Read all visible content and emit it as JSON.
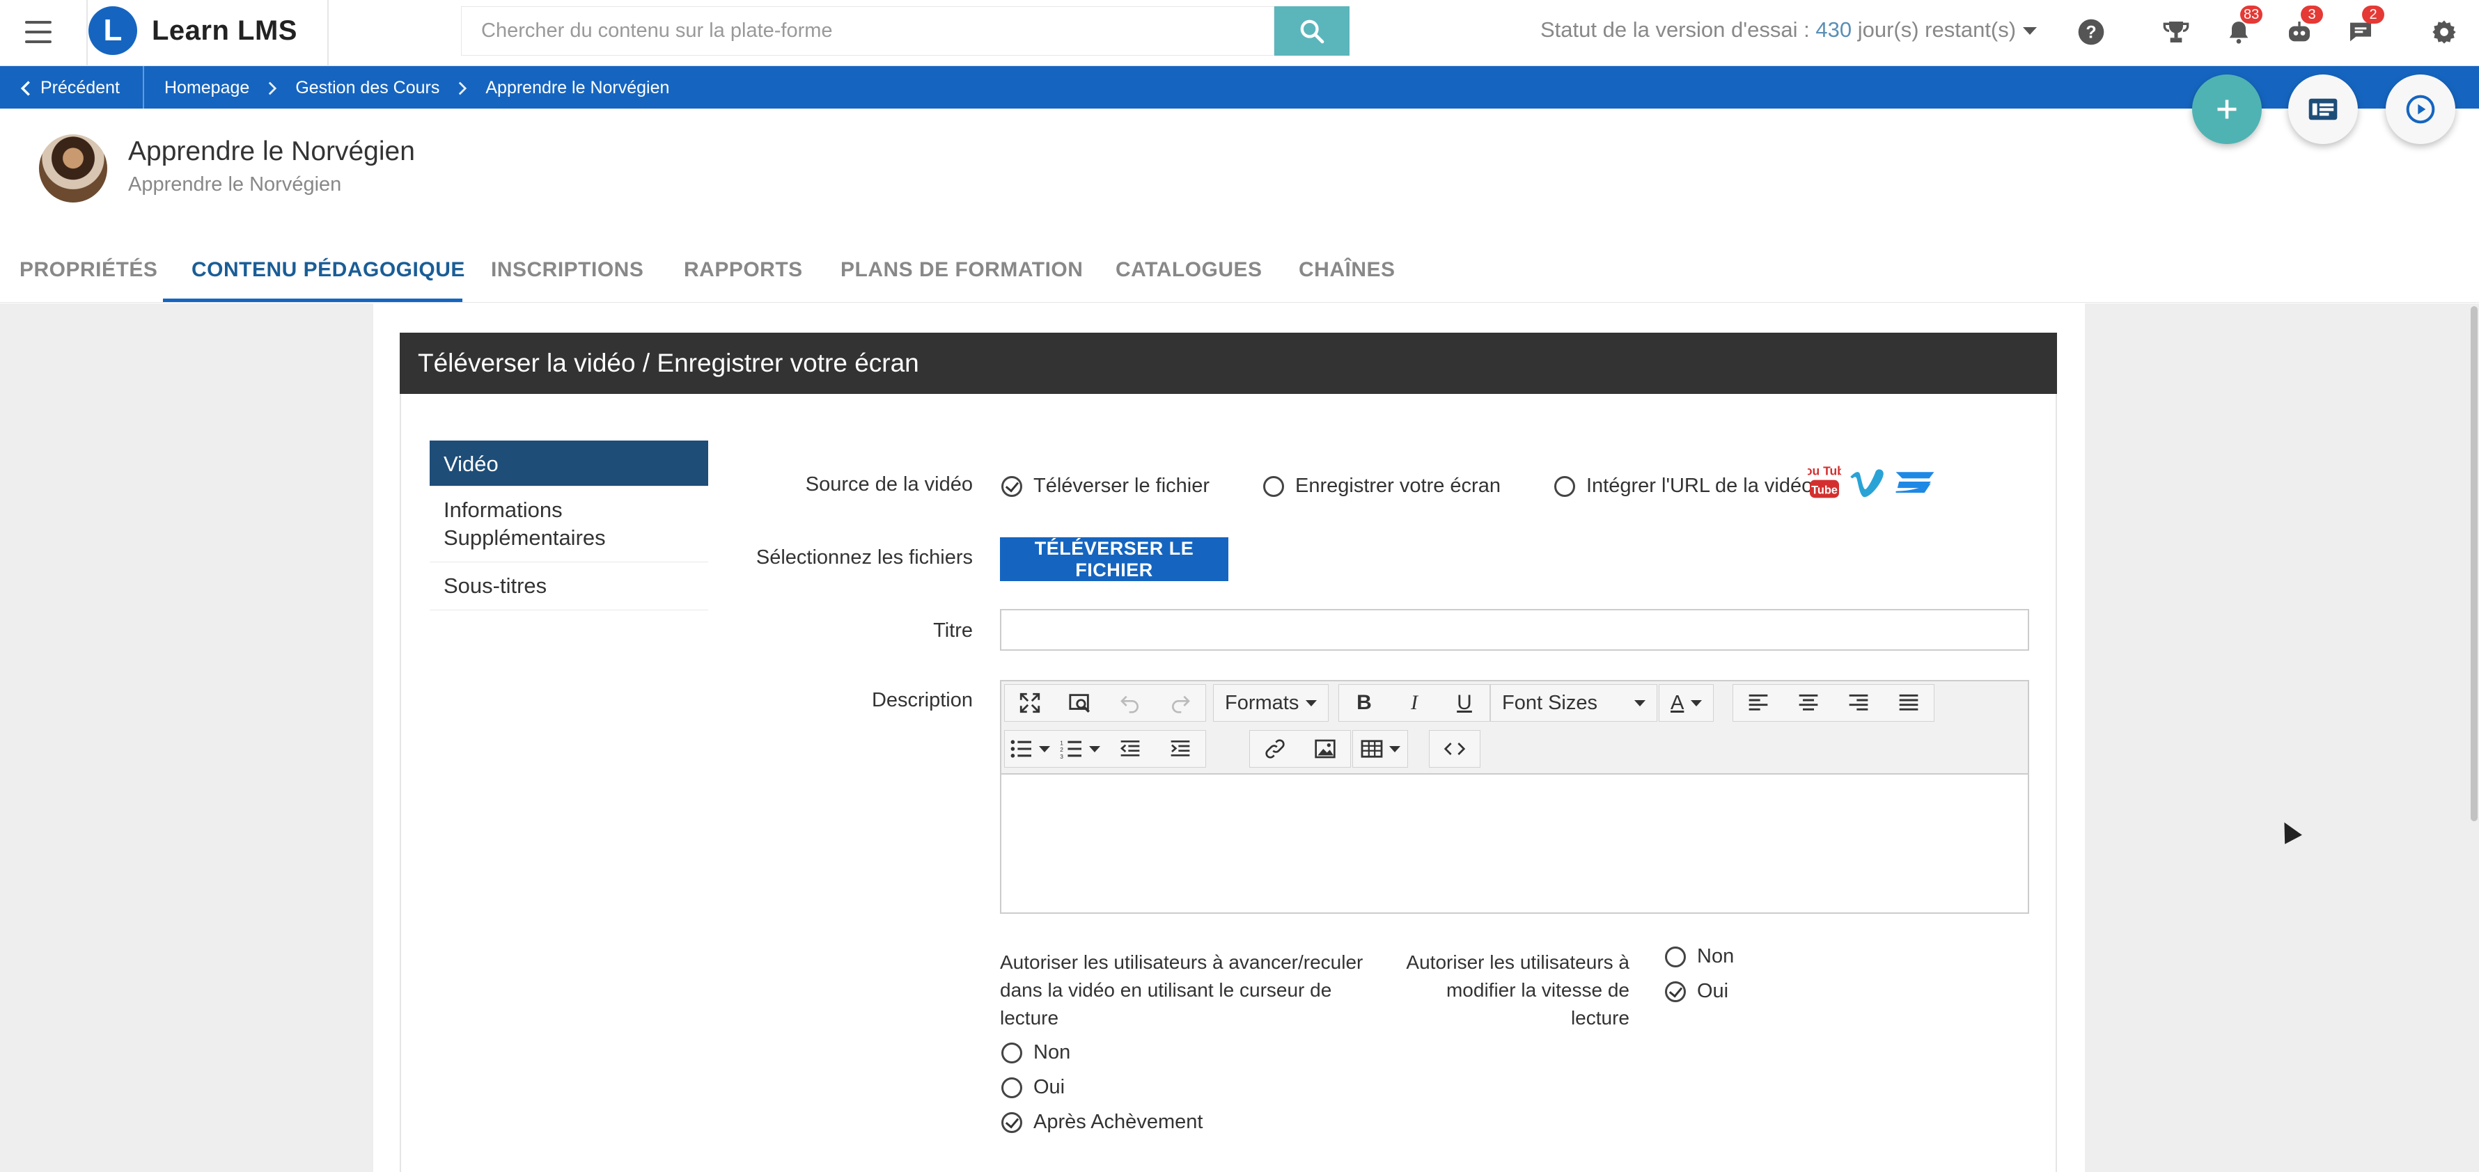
{
  "header": {
    "app_name": "Learn LMS",
    "logo_letter": "L",
    "search_placeholder": "Chercher du contenu sur la plate-forme",
    "trial_label": "Statut de la version d'essai : ",
    "trial_days": "430",
    "trial_suffix": " jour(s) restant(s)",
    "badges": {
      "notifications": "83",
      "bot": "3",
      "messages": "2"
    }
  },
  "breadcrumb": {
    "back": "Précédent",
    "items": [
      "Homepage",
      "Gestion des Cours",
      "Apprendre le Norvégien"
    ]
  },
  "course": {
    "title": "Apprendre le Norvégien",
    "subtitle": "Apprendre le Norvégien"
  },
  "tabs": [
    "PROPRIÉTÉS",
    "CONTENU PÉDAGOGIQUE",
    "INSCRIPTIONS",
    "RAPPORTS",
    "PLANS DE FORMATION",
    "CATALOGUES",
    "CHAÎNES"
  ],
  "panel": {
    "title": "Téléverser la vidéo / Enregistrer votre écran",
    "side_menu": [
      "Vidéo",
      "Informations Supplémentaires",
      "Sous-titres"
    ]
  },
  "form": {
    "source_label": "Source de la vidéo",
    "source_options": [
      "Téléverser le fichier",
      "Enregistrer votre écran",
      "Intégrer l'URL de la vidéo"
    ],
    "select_files_label": "Sélectionnez les fichiers",
    "upload_button": "TÉLÉVERSER LE FICHIER",
    "title_label": "Titre",
    "title_value": "",
    "description_label": "Description",
    "editor": {
      "formats": "Formats",
      "font_sizes": "Font Sizes"
    },
    "seek_label": "Autoriser les utilisateurs à avancer/reculer dans la vidéo en utilisant le curseur de lecture",
    "seek_options": [
      "Non",
      "Oui",
      "Après Achèvement"
    ],
    "speed_label": "Autoriser les utilisateurs à modifier la vitesse de lecture",
    "speed_options": [
      "Non",
      "Oui"
    ],
    "youtube_text": "You Tube"
  },
  "colors": {
    "primary": "#1565c0",
    "teal": "#5bb6bb",
    "panel_header": "#333333",
    "side_active": "#1e4d78",
    "badge": "#e53935"
  }
}
